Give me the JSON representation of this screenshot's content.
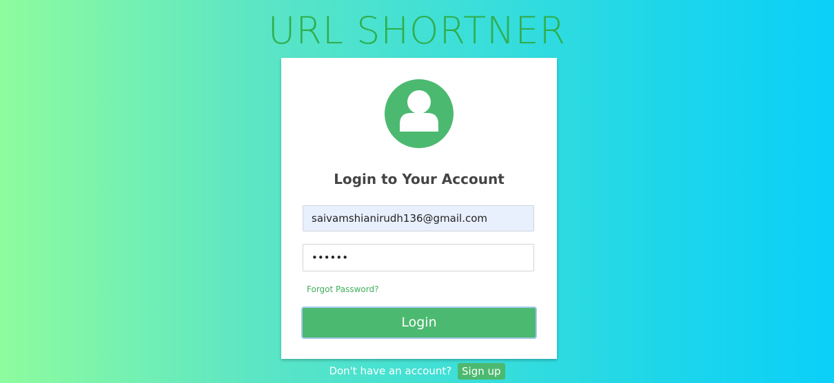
{
  "app": {
    "title": "URL SHORTNER"
  },
  "login_card": {
    "heading": "Login to Your Account",
    "avatar_icon": "user-icon",
    "email": {
      "value": "saivamshianirudh136@gmail.com"
    },
    "password": {
      "masked_value": "••••••"
    },
    "forgot_password_label": "Forgot Password?",
    "login_label": "Login"
  },
  "signup": {
    "prompt": "Don't have an account?",
    "button_label": "Sign up"
  },
  "colors": {
    "accent_green": "#4cb970",
    "title_green": "#2fae4e",
    "email_autofill_bg": "#e8f0fe",
    "gradient_start": "#8efc9e",
    "gradient_end": "#0bd0f8"
  }
}
